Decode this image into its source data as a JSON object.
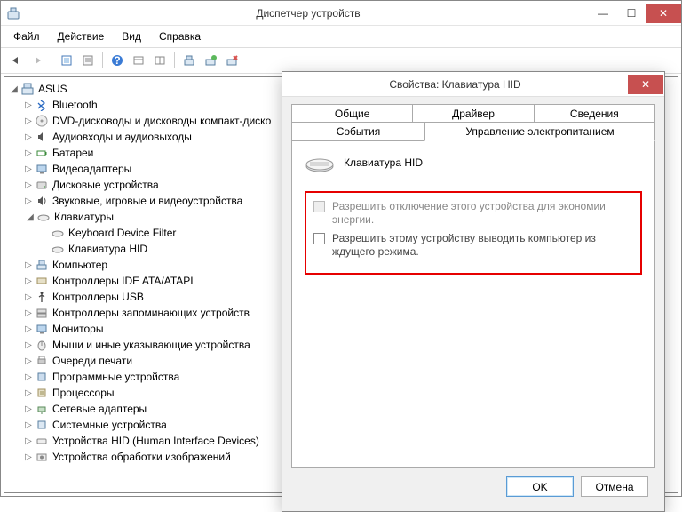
{
  "window": {
    "title": "Диспетчер устройств",
    "min_glyph": "—",
    "max_glyph": "☐",
    "close_glyph": "✕"
  },
  "menu": {
    "file": "Файл",
    "action": "Действие",
    "view": "Вид",
    "help": "Справка"
  },
  "tree": {
    "root": "ASUS",
    "items": [
      {
        "label": "Bluetooth",
        "icon": "bluetooth"
      },
      {
        "label": "DVD-дисководы и дисководы компакт-диско",
        "icon": "disc"
      },
      {
        "label": "Аудиовходы и аудиовыходы",
        "icon": "audio"
      },
      {
        "label": "Батареи",
        "icon": "battery"
      },
      {
        "label": "Видеоадаптеры",
        "icon": "display"
      },
      {
        "label": "Дисковые устройства",
        "icon": "hdd"
      },
      {
        "label": "Звуковые, игровые и видеоустройства",
        "icon": "sound"
      }
    ],
    "keyboard_label": "Клавиатуры",
    "keyboard_children": [
      {
        "label": "Keyboard Device Filter"
      },
      {
        "label": "Клавиатура HID"
      }
    ],
    "items2": [
      {
        "label": "Компьютер",
        "icon": "pc"
      },
      {
        "label": "Контроллеры IDE ATA/ATAPI",
        "icon": "ide"
      },
      {
        "label": "Контроллеры USB",
        "icon": "usb"
      },
      {
        "label": "Контроллеры запоминающих устройств",
        "icon": "storage"
      },
      {
        "label": "Мониторы",
        "icon": "monitor"
      },
      {
        "label": "Мыши и иные указывающие устройства",
        "icon": "mouse"
      },
      {
        "label": "Очереди печати",
        "icon": "printer"
      },
      {
        "label": "Программные устройства",
        "icon": "software"
      },
      {
        "label": "Процессоры",
        "icon": "cpu"
      },
      {
        "label": "Сетевые адаптеры",
        "icon": "network"
      },
      {
        "label": "Системные устройства",
        "icon": "chip"
      },
      {
        "label": "Устройства HID (Human Interface Devices)",
        "icon": "hid"
      },
      {
        "label": "Устройства обработки изображений",
        "icon": "imaging"
      }
    ]
  },
  "dialog": {
    "title": "Свойства: Клавиатура HID",
    "close_glyph": "✕",
    "tabs": {
      "general": "Общие",
      "driver": "Драйвер",
      "details": "Сведения",
      "events": "События",
      "power": "Управление электропитанием"
    },
    "device_name": "Клавиатура HID",
    "chk1": "Разрешить отключение этого устройства для экономии энергии.",
    "chk2": "Разрешить этому устройству выводить компьютер из ждущего режима.",
    "ok": "OK",
    "cancel": "Отмена"
  }
}
